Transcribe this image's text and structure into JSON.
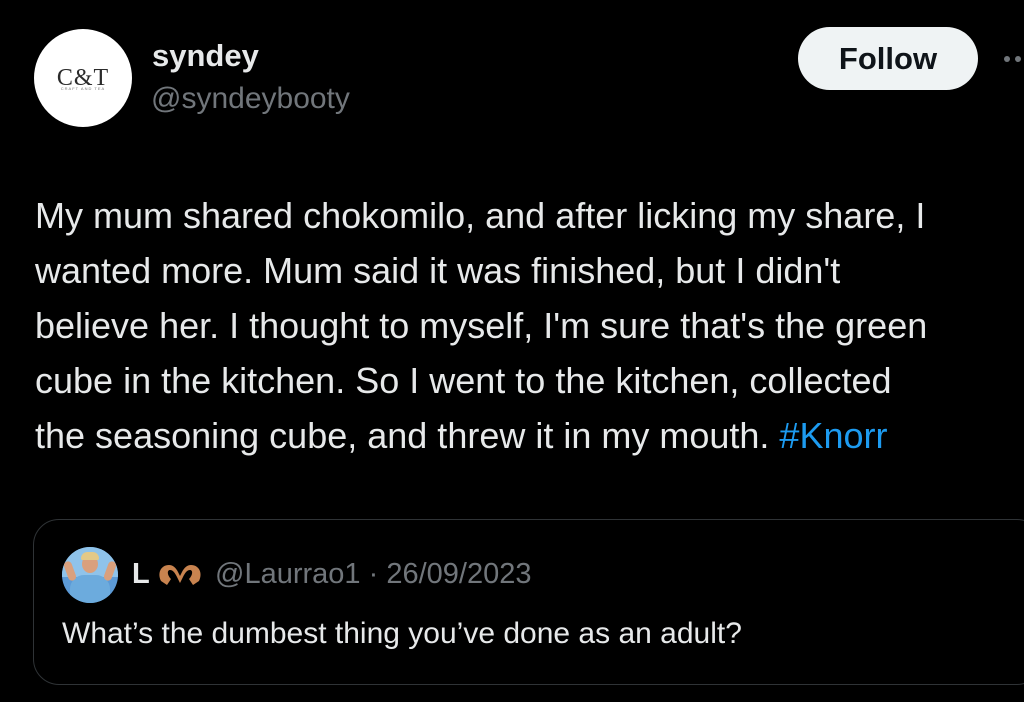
{
  "author": {
    "avatar_logo": "C&T",
    "avatar_subtext": "CRAFT AND TEA",
    "display_name": "syndey",
    "handle": "@syndeybooty"
  },
  "actions": {
    "follow_label": "Follow",
    "more_icon": "more-horizontal-icon"
  },
  "tweet": {
    "lines": [
      "My mum shared chokomilo, and after licking my share, I",
      "wanted more. Mum said it was finished, but I didn't",
      "believe her. I thought to myself, I'm sure that's the green",
      "cube in the kitchen. So I went to the kitchen, collected",
      "the seasoning cube, and threw it in my mouth. "
    ],
    "hashtag": "#Knorr"
  },
  "quoted_tweet": {
    "display_name": "L",
    "name_emoji": "heart-hands-icon",
    "handle": "@Laurrao1",
    "separator": " · ",
    "date": "26/09/2023",
    "text": "What’s the dumbest thing you’ve done as an adult?"
  },
  "colors": {
    "background": "#000000",
    "text": "#e7e9ea",
    "secondary": "#71767b",
    "link": "#1d9bf0",
    "border": "#2f3336",
    "button_bg": "#eff3f4"
  }
}
